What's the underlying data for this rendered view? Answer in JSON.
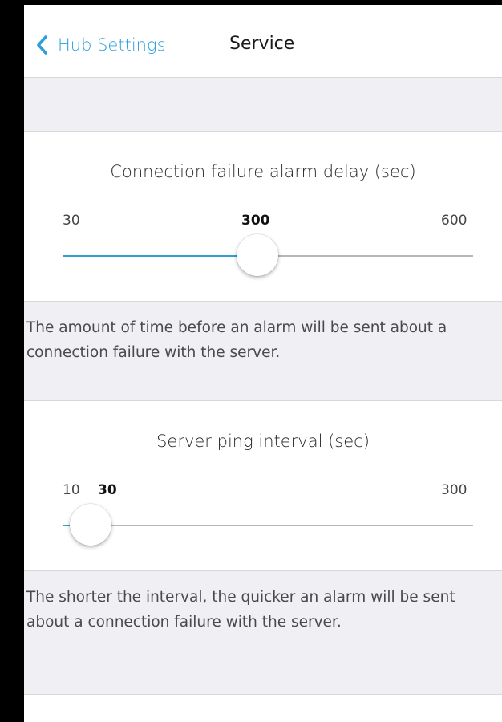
{
  "nav": {
    "back_label": "Hub Settings",
    "title": "Service"
  },
  "sliders": [
    {
      "title": "Connection failure alarm delay (sec)",
      "min_label": "30",
      "value_label": "300",
      "max_label": "600",
      "min": 30,
      "max": 600,
      "value": 300,
      "description": "The amount of time before an alarm will be sent about a connection failure with the server."
    },
    {
      "title": "Server ping interval (sec)",
      "min_label": "10",
      "value_label": "30",
      "max_label": "300",
      "min": 10,
      "max": 300,
      "value": 30,
      "description": "The shorter the interval, the quicker an alarm will be sent about a connection failure with the server."
    }
  ],
  "colors": {
    "accent": "#2d9fd9",
    "group_background": "#efeff4",
    "track": "#b7b7b7"
  },
  "icons": {
    "back": "chevron-left-icon"
  }
}
